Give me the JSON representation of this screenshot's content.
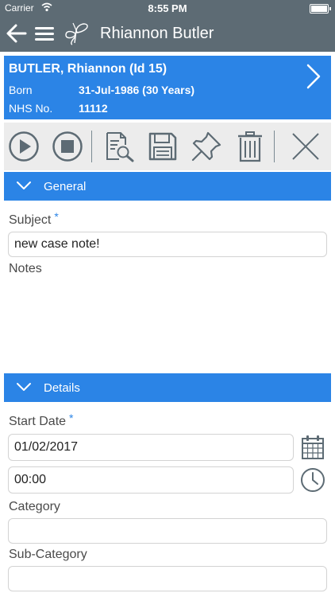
{
  "status_bar": {
    "carrier": "Carrier",
    "time": "8:55 PM"
  },
  "nav": {
    "title": "Rhiannon Butler",
    "icons": [
      "back-arrow-icon",
      "hamburger-menu-icon",
      "butterfly-logo-icon"
    ]
  },
  "patient": {
    "name": "BUTLER, Rhiannon (Id 15)",
    "born_label": "Born",
    "born_value": "31-Jul-1986 (30 Years)",
    "nhs_label": "NHS No.",
    "nhs_value": "11112"
  },
  "toolbar": {
    "icons": [
      "play-icon",
      "stop-icon",
      "preview-icon",
      "save-icon",
      "pin-icon",
      "trash-icon",
      "close-icon"
    ]
  },
  "sections": {
    "general": "General",
    "details": "Details"
  },
  "general": {
    "subject_label": "Subject",
    "required_mark": "*",
    "subject_value": "new case note!",
    "notes_label": "Notes",
    "notes_value": ""
  },
  "details": {
    "start_date_label": "Start Date",
    "required_mark": "*",
    "date_value": "01/02/2017",
    "time_value": "00:00",
    "category_label": "Category",
    "category_value": "",
    "subcategory_label": "Sub-Category",
    "subcategory_value": ""
  },
  "colors": {
    "nav_bg": "#5d6b74",
    "accent": "#2b84e6",
    "toolbar_bg": "#ececec",
    "icon_gray": "#5d6b74"
  }
}
